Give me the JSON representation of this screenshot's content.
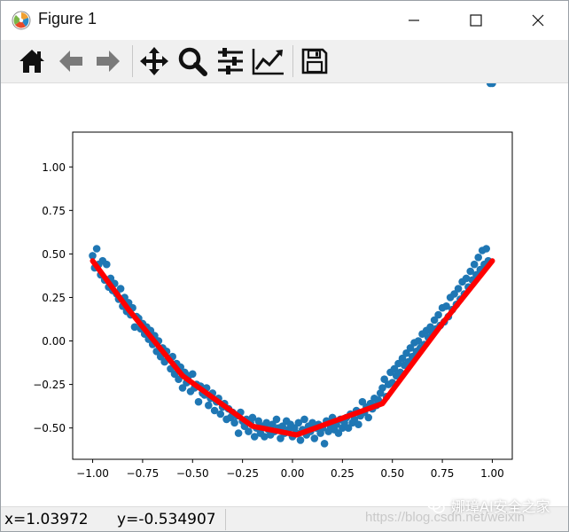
{
  "window": {
    "title": "Figure 1",
    "controls": {
      "minimize_icon": "minimize-icon",
      "maximize_icon": "maximize-icon",
      "close_icon": "close-icon"
    }
  },
  "toolbar": {
    "buttons": [
      {
        "name": "home-button",
        "icon": "home-icon"
      },
      {
        "name": "back-button",
        "icon": "arrow-left-icon"
      },
      {
        "name": "forward-button",
        "icon": "arrow-right-icon"
      },
      {
        "name": "pan-button",
        "icon": "move-icon"
      },
      {
        "name": "zoom-button",
        "icon": "magnifier-icon"
      },
      {
        "name": "subplots-button",
        "icon": "sliders-icon"
      },
      {
        "name": "edit-axes-button",
        "icon": "line-chart-icon"
      },
      {
        "name": "save-button",
        "icon": "floppy-disk-icon"
      }
    ]
  },
  "status": {
    "x_text": "x=1.03972",
    "y_text": "y=-0.534907",
    "watermark_url": "https://blog.csdn.net/weixin",
    "watermark_brand": "娜璋AI安全之家"
  },
  "colors": {
    "scatter": "#1f77b4",
    "fit_line": "#ff0000",
    "toolbar_bg": "#f0f0f0",
    "axes": "#000000"
  },
  "chart_data": {
    "type": "scatter",
    "title": "",
    "xlabel": "",
    "ylabel": "",
    "xlim": [
      -1.1,
      1.1
    ],
    "ylim": [
      -0.68,
      1.2
    ],
    "grid": false,
    "legend": "none",
    "x_ticks": [
      "−1.00",
      "−0.75",
      "−0.50",
      "−0.25",
      "0.00",
      "0.25",
      "0.50",
      "0.75",
      "1.00"
    ],
    "x_tick_values": [
      -1.0,
      -0.75,
      -0.5,
      -0.25,
      0.0,
      0.25,
      0.5,
      0.75,
      1.0
    ],
    "y_ticks": [
      "−0.50",
      "−0.25",
      "0.00",
      "0.25",
      "0.50",
      "0.75",
      "1.00"
    ],
    "y_tick_values": [
      -0.5,
      -0.25,
      0.0,
      0.25,
      0.5,
      0.75,
      1.0
    ],
    "scatter": {
      "x": [
        -1.0,
        -0.99,
        -0.98,
        -0.97,
        -0.96,
        -0.95,
        -0.94,
        -0.93,
        -0.92,
        -0.91,
        -0.9,
        -0.89,
        -0.88,
        -0.87,
        -0.86,
        -0.85,
        -0.84,
        -0.83,
        -0.82,
        -0.81,
        -0.8,
        -0.79,
        -0.78,
        -0.77,
        -0.76,
        -0.75,
        -0.74,
        -0.73,
        -0.72,
        -0.71,
        -0.7,
        -0.69,
        -0.68,
        -0.67,
        -0.66,
        -0.65,
        -0.64,
        -0.63,
        -0.62,
        -0.61,
        -0.6,
        -0.59,
        -0.58,
        -0.57,
        -0.56,
        -0.55,
        -0.54,
        -0.53,
        -0.52,
        -0.51,
        -0.5,
        -0.49,
        -0.48,
        -0.47,
        -0.46,
        -0.45,
        -0.44,
        -0.43,
        -0.42,
        -0.41,
        -0.4,
        -0.39,
        -0.38,
        -0.37,
        -0.36,
        -0.35,
        -0.34,
        -0.33,
        -0.32,
        -0.31,
        -0.3,
        -0.29,
        -0.28,
        -0.27,
        -0.26,
        -0.25,
        -0.24,
        -0.23,
        -0.22,
        -0.21,
        -0.2,
        -0.19,
        -0.18,
        -0.17,
        -0.16,
        -0.15,
        -0.14,
        -0.13,
        -0.12,
        -0.11,
        -0.1,
        -0.09,
        -0.08,
        -0.07,
        -0.06,
        -0.05,
        -0.04,
        -0.03,
        -0.02,
        -0.01,
        0.0,
        0.01,
        0.02,
        0.03,
        0.04,
        0.05,
        0.06,
        0.07,
        0.08,
        0.09,
        0.1,
        0.11,
        0.12,
        0.13,
        0.14,
        0.15,
        0.16,
        0.17,
        0.18,
        0.19,
        0.2,
        0.21,
        0.22,
        0.23,
        0.24,
        0.25,
        0.26,
        0.27,
        0.28,
        0.29,
        0.3,
        0.31,
        0.32,
        0.33,
        0.34,
        0.35,
        0.36,
        0.37,
        0.38,
        0.39,
        0.4,
        0.41,
        0.42,
        0.43,
        0.44,
        0.45,
        0.46,
        0.47,
        0.48,
        0.49,
        0.5,
        0.51,
        0.52,
        0.53,
        0.54,
        0.55,
        0.56,
        0.57,
        0.58,
        0.59,
        0.6,
        0.61,
        0.62,
        0.63,
        0.64,
        0.65,
        0.66,
        0.67,
        0.68,
        0.69,
        0.7,
        0.71,
        0.72,
        0.73,
        0.74,
        0.75,
        0.76,
        0.77,
        0.78,
        0.79,
        0.8,
        0.81,
        0.82,
        0.83,
        0.84,
        0.85,
        0.86,
        0.87,
        0.88,
        0.89,
        0.9,
        0.91,
        0.92,
        0.93,
        0.94,
        0.95,
        0.96,
        0.97,
        0.98,
        0.99,
        1.0
      ],
      "y": [
        0.49,
        0.42,
        0.53,
        0.44,
        0.38,
        0.46,
        0.35,
        0.44,
        0.31,
        0.36,
        0.29,
        0.33,
        0.27,
        0.24,
        0.3,
        0.2,
        0.25,
        0.17,
        0.22,
        0.15,
        0.19,
        0.08,
        0.14,
        0.13,
        0.07,
        0.1,
        0.04,
        0.08,
        0.01,
        0.06,
        -0.02,
        0.03,
        -0.06,
        0.0,
        -0.09,
        -0.04,
        -0.12,
        -0.06,
        -0.1,
        -0.16,
        -0.09,
        -0.19,
        -0.13,
        -0.22,
        -0.15,
        -0.27,
        -0.18,
        -0.24,
        -0.2,
        -0.29,
        -0.19,
        -0.27,
        -0.25,
        -0.35,
        -0.26,
        -0.3,
        -0.31,
        -0.27,
        -0.37,
        -0.33,
        -0.3,
        -0.4,
        -0.35,
        -0.33,
        -0.42,
        -0.38,
        -0.36,
        -0.45,
        -0.39,
        -0.44,
        -0.41,
        -0.47,
        -0.43,
        -0.53,
        -0.41,
        -0.46,
        -0.49,
        -0.45,
        -0.52,
        -0.47,
        -0.44,
        -0.55,
        -0.5,
        -0.46,
        -0.53,
        -0.49,
        -0.55,
        -0.47,
        -0.51,
        -0.54,
        -0.48,
        -0.52,
        -0.45,
        -0.5,
        -0.56,
        -0.49,
        -0.53,
        -0.46,
        -0.51,
        -0.48,
        -0.55,
        -0.5,
        -0.53,
        -0.47,
        -0.57,
        -0.51,
        -0.45,
        -0.54,
        -0.49,
        -0.52,
        -0.47,
        -0.56,
        -0.5,
        -0.48,
        -0.53,
        -0.5,
        -0.59,
        -0.46,
        -0.52,
        -0.49,
        -0.44,
        -0.51,
        -0.48,
        -0.53,
        -0.45,
        -0.5,
        -0.47,
        -0.44,
        -0.5,
        -0.42,
        -0.47,
        -0.45,
        -0.4,
        -0.48,
        -0.43,
        -0.35,
        -0.41,
        -0.38,
        -0.44,
        -0.36,
        -0.39,
        -0.33,
        -0.37,
        -0.34,
        -0.3,
        -0.27,
        -0.22,
        -0.32,
        -0.25,
        -0.18,
        -0.24,
        -0.16,
        -0.2,
        -0.13,
        -0.18,
        -0.1,
        -0.14,
        -0.07,
        -0.12,
        -0.04,
        -0.09,
        -0.01,
        -0.06,
        0.0,
        -0.04,
        0.04,
        -0.02,
        0.06,
        0.02,
        0.08,
        0.05,
        0.12,
        0.07,
        0.15,
        0.09,
        0.19,
        0.11,
        0.2,
        0.14,
        0.25,
        0.18,
        0.27,
        0.21,
        0.3,
        0.24,
        0.34,
        0.27,
        0.36,
        0.31,
        0.4,
        0.35,
        0.44,
        0.38,
        0.48,
        0.41,
        0.52,
        0.44,
        0.53,
        0.46
      ]
    },
    "fit_line": {
      "x": [
        -1.0,
        -0.82,
        -0.55,
        -0.2,
        0.02,
        0.45,
        0.75,
        1.0
      ],
      "y": [
        0.46,
        0.18,
        -0.2,
        -0.49,
        -0.54,
        -0.36,
        0.1,
        0.46
      ]
    }
  }
}
